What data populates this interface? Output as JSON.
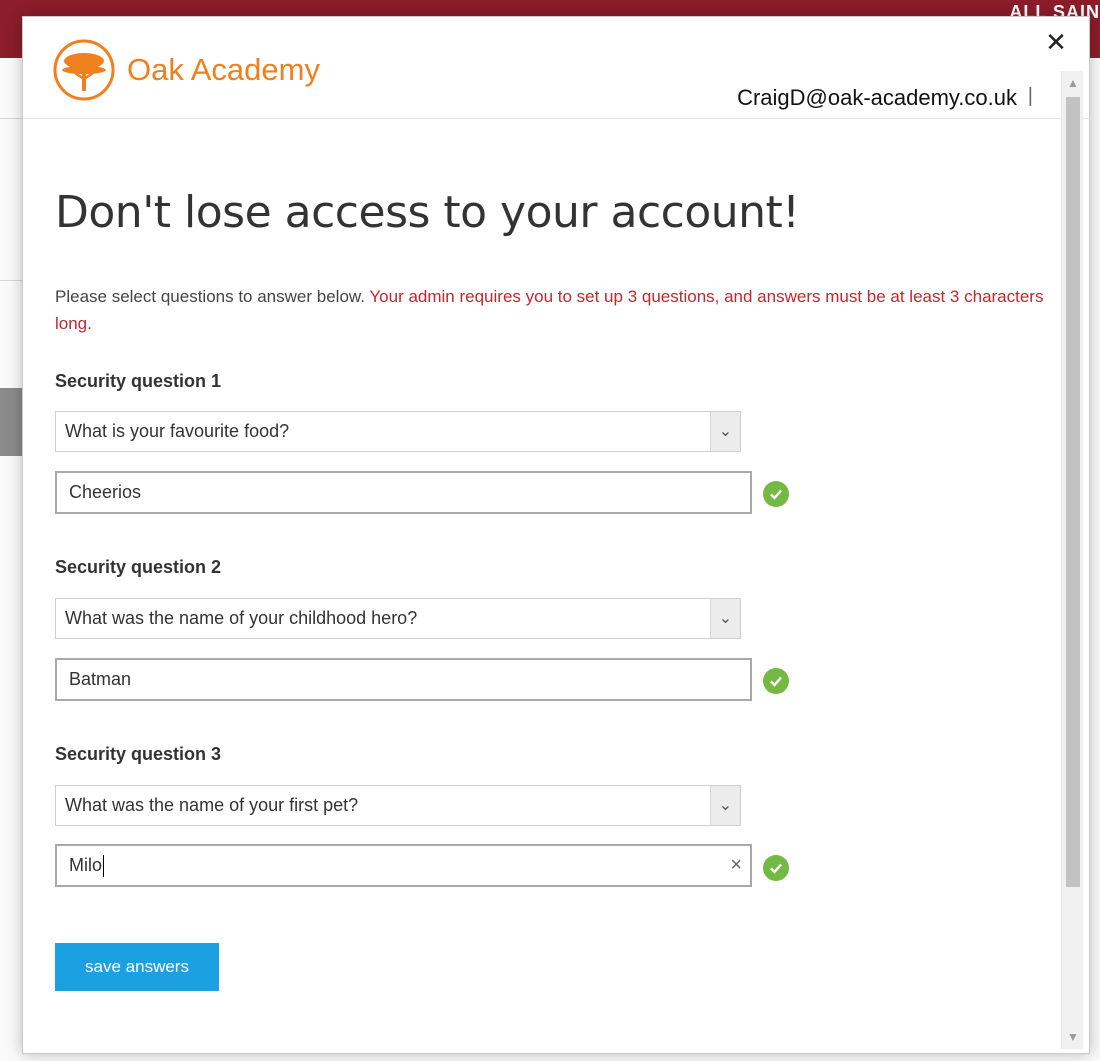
{
  "background": {
    "banner_text": "ALL SAIN"
  },
  "header": {
    "logo_text": "Oak Academy",
    "user_email": "CraigD@oak-academy.co.uk",
    "separator": "|"
  },
  "main": {
    "title": "Don't lose access to your account!",
    "instructions": "Please select questions to answer below.",
    "requirement": "Your admin requires you to set up 3 questions, and answers must be at least 3 characters long.",
    "questions": [
      {
        "label": "Security question 1",
        "selected": "What is your favourite food?",
        "answer": "Cheerios",
        "valid": true
      },
      {
        "label": "Security question 2",
        "selected": "What was the name of your childhood hero?",
        "answer": "Batman",
        "valid": true
      },
      {
        "label": "Security question 3",
        "selected": "What was the name of your first pet?",
        "answer": "Milo",
        "valid": true
      }
    ],
    "save_label": "save answers"
  },
  "colors": {
    "brand": "#f07f1e",
    "banner": "#8c1d2b",
    "requirement": "#c4262e",
    "accent": "#1ba1e2",
    "valid": "#74b943"
  },
  "icons": [
    "oak-tree-logo-icon",
    "close-icon",
    "chevron-down-icon",
    "check-circle-icon",
    "clear-icon"
  ]
}
